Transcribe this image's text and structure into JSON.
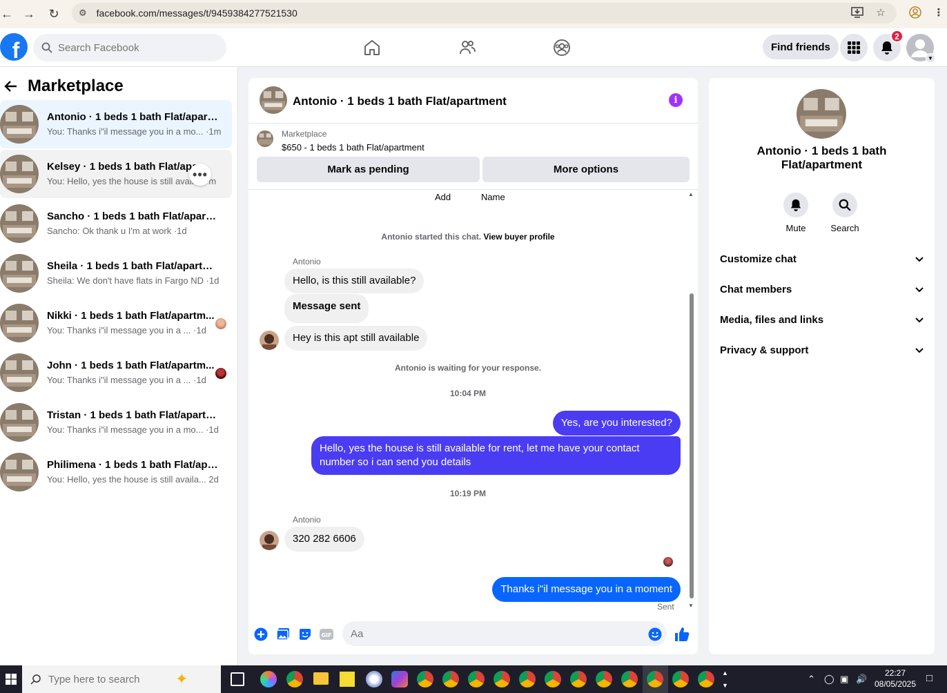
{
  "browser": {
    "url": "facebook.com/messages/t/9459384277521530"
  },
  "header": {
    "search_placeholder": "Search Facebook",
    "find_friends_label": "Find friends",
    "notifications_count": "2"
  },
  "sidebar": {
    "title": "Marketplace",
    "conversations": [
      {
        "name": "Antonio · 1 beds 1 bath Flat/apart...",
        "preview": "You: Thanks i\"il message you in a mo... ·1m"
      },
      {
        "name": "Kelsey · 1 beds 1 bath Flat/apar...",
        "preview": "You: Hello, yes the house is still availa... m"
      },
      {
        "name": "Sancho · 1 beds 1 bath Flat/apartm...",
        "preview": "Sancho: Ok thank u I'm at work ·1d"
      },
      {
        "name": "Sheila · 1 beds 1 bath Flat/apartment",
        "preview": "Sheila: We don't have flats in Fargo ND ·1d"
      },
      {
        "name": "Nikki · 1 beds 1 bath Flat/apartm...",
        "preview": "You: Thanks i\"il message you in a ...   ·1d"
      },
      {
        "name": "John · 1 beds 1 bath Flat/apartm...",
        "preview": "You: Thanks i\"il message you in a ...   ·1d"
      },
      {
        "name": "Tristan · 1 beds 1 bath Flat/apartm...",
        "preview": "You: Thanks i\"il message you in a mo...  ·1d"
      },
      {
        "name": "Philimena · 1 beds 1 bath Flat/apar...",
        "preview": "You: Hello, yes the house is still availa...  2d"
      }
    ]
  },
  "chat": {
    "title": "Antonio · 1 beds 1 bath Flat/apartment",
    "listing_label": "Marketplace",
    "listing_price": "$650 - 1 beds 1 bath Flat/apartment",
    "mark_pending": "Mark as pending",
    "more_options": "More options",
    "cut_add": "Add",
    "cut_name": "Name",
    "started_text": "Antonio started this chat.",
    "view_buyer": "View buyer profile",
    "sender_name": "Antonio",
    "msg1": "Hello, is this still available?",
    "msg2": "Message sent",
    "msg3": "Hey is this apt still available",
    "waiting": "Antonio is waiting for your response.",
    "time1": "10:04 PM",
    "out1": "Yes, are you interested?",
    "out2_line1": "Hello, yes the house is still available for rent, let me have your contact",
    "out2_line2": "number so i can send you details",
    "time2": "10:19 PM",
    "sender_name2": "Antonio",
    "msg4": "320 282 6606",
    "out3": "Thanks i\"il message you in a moment",
    "sent_status": "Sent",
    "composer_placeholder": "Aa"
  },
  "details": {
    "title_line1": "Antonio · 1 beds 1 bath",
    "title_line2": "Flat/apartment",
    "mute": "Mute",
    "search": "Search",
    "rows": [
      "Customize chat",
      "Chat members",
      "Media, files and links",
      "Privacy & support"
    ]
  },
  "taskbar": {
    "search_placeholder": "Type here to search",
    "time": "22:27",
    "date": "08/05/2025"
  }
}
